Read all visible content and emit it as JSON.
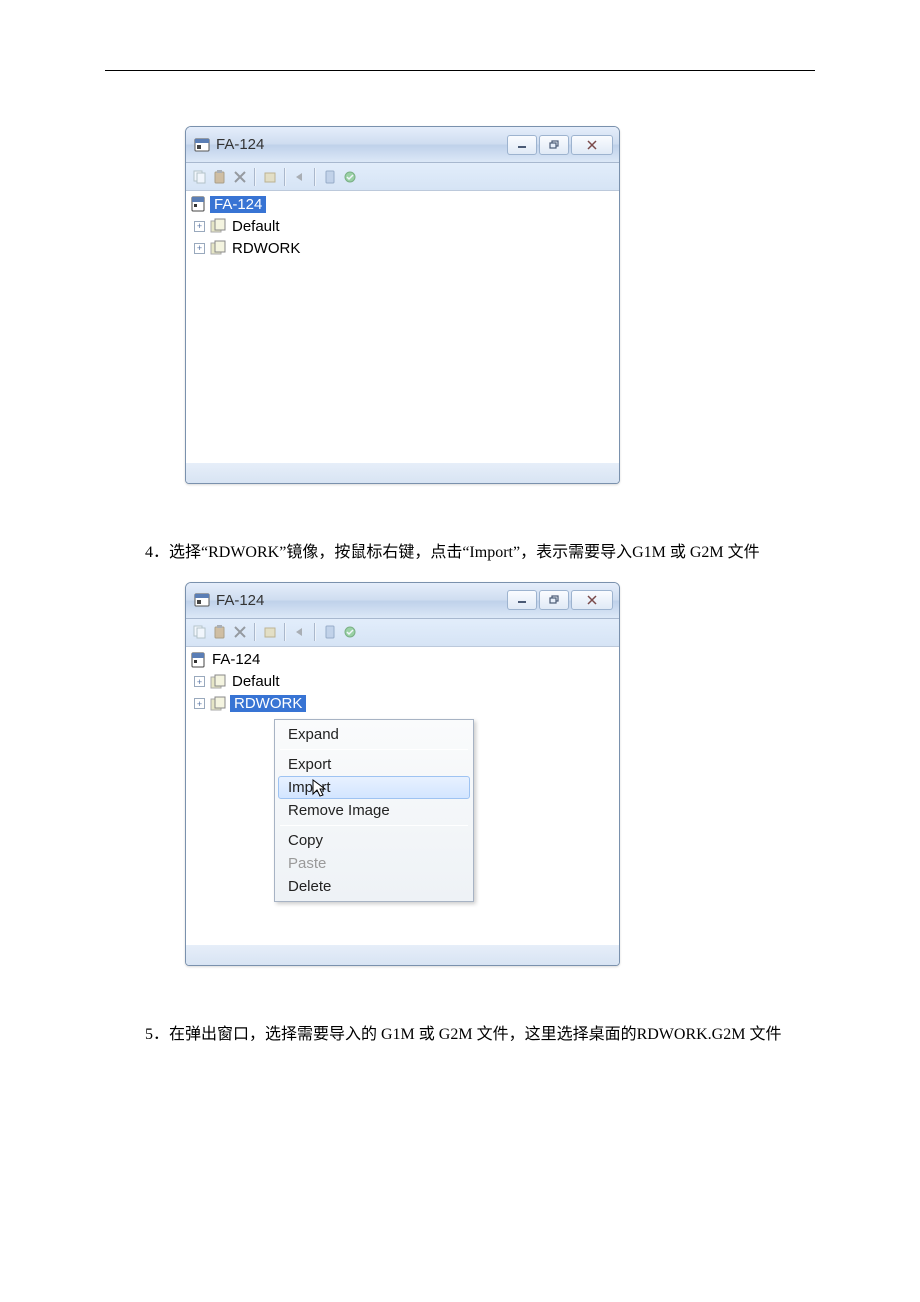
{
  "window1": {
    "title": "FA-124",
    "tree": {
      "root": "FA-124",
      "items": [
        "Default",
        "RDWORK"
      ],
      "selected": "FA-124"
    }
  },
  "step4": "4．选择“RDWORK”镜像，按鼠标右键，点击“Import”，表示需要导入G1M 或 G2M 文件",
  "window2": {
    "title": "FA-124",
    "tree": {
      "root": "FA-124",
      "items": [
        "Default",
        "RDWORK"
      ],
      "selected": "RDWORK"
    },
    "context_menu": {
      "items": [
        {
          "label": "Expand",
          "disabled": false
        },
        {
          "sep": true
        },
        {
          "label": "Export",
          "disabled": false
        },
        {
          "label": "Import",
          "disabled": false,
          "hover": true
        },
        {
          "label": "Remove Image",
          "disabled": false
        },
        {
          "sep": true
        },
        {
          "label": "Copy",
          "disabled": false
        },
        {
          "label": "Paste",
          "disabled": true
        },
        {
          "label": "Delete",
          "disabled": false
        }
      ]
    }
  },
  "step5": "5．在弹出窗口，选择需要导入的 G1M 或 G2M 文件，这里选择桌面的RDWORK.G2M 文件"
}
